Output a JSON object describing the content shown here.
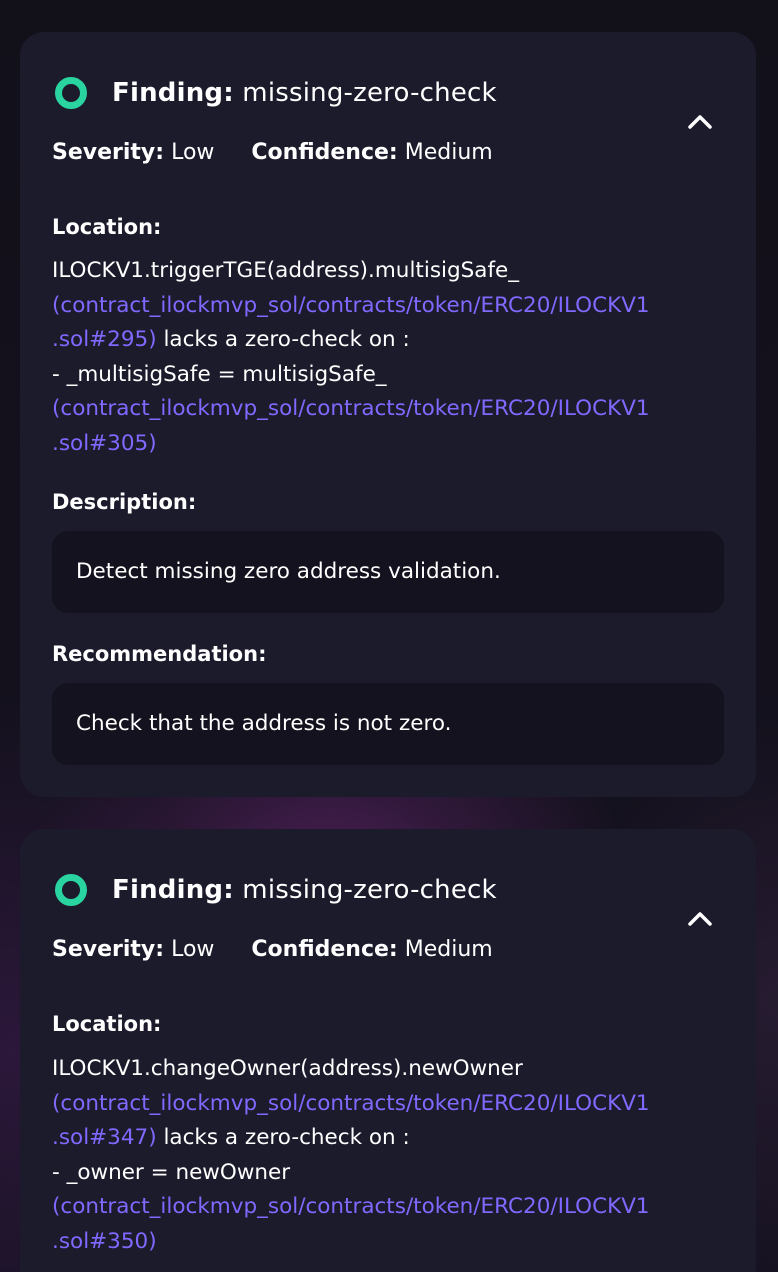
{
  "findings": [
    {
      "finding_label": "Finding:",
      "finding_name": "missing-zero-check",
      "severity_label": "Severity:",
      "severity_value": "Low",
      "confidence_label": "Confidence:",
      "confidence_value": "Medium",
      "location_label": "Location:",
      "location": {
        "line1": "ILOCKV1.triggerTGE(address).multisigSafe_",
        "link1_part1": "(contract_ilockmvp_sol/contracts/token/ERC20/ILOCKV1",
        "link1_part2": ".sol#295)",
        "mid_text": " lacks a zero-check on :",
        "line4": "- _multisigSafe = multisigSafe_",
        "link2_part1": "(contract_ilockmvp_sol/contracts/token/ERC20/ILOCKV1",
        "link2_part2": ".sol#305)"
      },
      "description_label": "Description:",
      "description": "Detect missing zero address validation.",
      "recommendation_label": "Recommendation:",
      "recommendation": "Check that the address is not zero."
    },
    {
      "finding_label": "Finding:",
      "finding_name": "missing-zero-check",
      "severity_label": "Severity:",
      "severity_value": "Low",
      "confidence_label": "Confidence:",
      "confidence_value": "Medium",
      "location_label": "Location:",
      "location": {
        "line1": "ILOCKV1.changeOwner(address).newOwner",
        "link1_part1": "(contract_ilockmvp_sol/contracts/token/ERC20/ILOCKV1",
        "link1_part2": ".sol#347)",
        "mid_text": " lacks a zero-check on :",
        "line4": "- _owner = newOwner",
        "link2_part1": "(contract_ilockmvp_sol/contracts/token/ERC20/ILOCKV1",
        "link2_part2": ".sol#350)"
      }
    }
  ],
  "colors": {
    "status_ring": "#29d4a0",
    "link": "#7f69ff",
    "card_bg": "#1c1b2c",
    "box_bg": "#13121e"
  },
  "icons": {
    "status": "status-ring-icon",
    "collapse": "chevron-up-icon"
  }
}
